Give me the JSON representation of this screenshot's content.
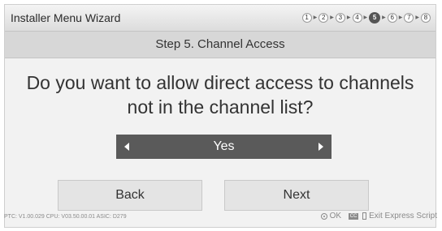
{
  "header": {
    "title": "Installer Menu Wizard",
    "steps": [
      "1",
      "2",
      "3",
      "4",
      "5",
      "6",
      "7",
      "8"
    ],
    "active_step": "5"
  },
  "subheader": {
    "title": "Step 5. Channel Access"
  },
  "question": "Do you want to allow direct access to channels not in the channel list?",
  "selector": {
    "value": "Yes"
  },
  "buttons": {
    "back": "Back",
    "next": "Next"
  },
  "footer": {
    "info": "PTC:  V1.00.029 CPU: V03.50.00.01 ASIC: D279",
    "ok_label": "OK",
    "cc_label": "CC",
    "exit_label": "Exit Express Script"
  },
  "colors": {
    "selector_bg": "#5a5a5a",
    "active_step": "#555555",
    "panel_bg": "#f2f2f2"
  }
}
